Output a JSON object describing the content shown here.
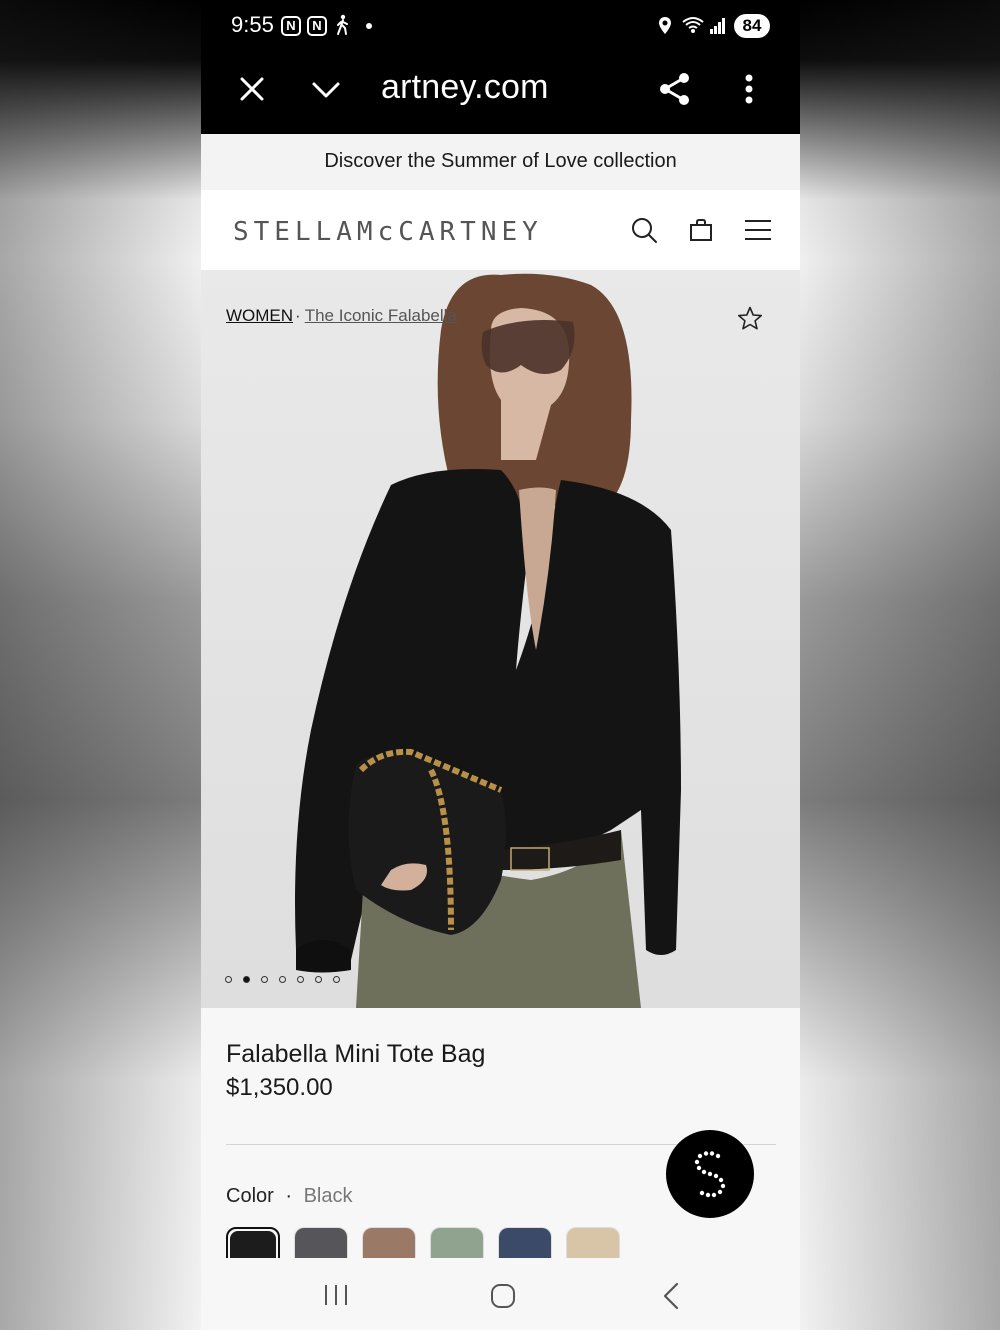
{
  "status_bar": {
    "time": "9:55",
    "battery": "84"
  },
  "browser": {
    "url": "artney.com"
  },
  "promo": {
    "text": "Discover the Summer of Love collection"
  },
  "header": {
    "logo": "STELLAMcCARTNEY"
  },
  "breadcrumb": {
    "women": "WOMEN",
    "separator": "·",
    "collection": "The Iconic Falabella"
  },
  "product": {
    "name": "Falabella Mini Tote Bag",
    "price": "$1,350.00",
    "color_label": "Color",
    "color_separator": "·",
    "color_value": "Black",
    "swatches": [
      "#1c1c1c",
      "#55555a",
      "#9a7a66",
      "#8fa38f",
      "#3b4a66",
      "#d8c4a6"
    ],
    "image_count": 7,
    "active_image": 2
  },
  "colors": {
    "accent": "#000000",
    "page_bg": "#ffffff",
    "info_bg": "#f7f7f7"
  }
}
